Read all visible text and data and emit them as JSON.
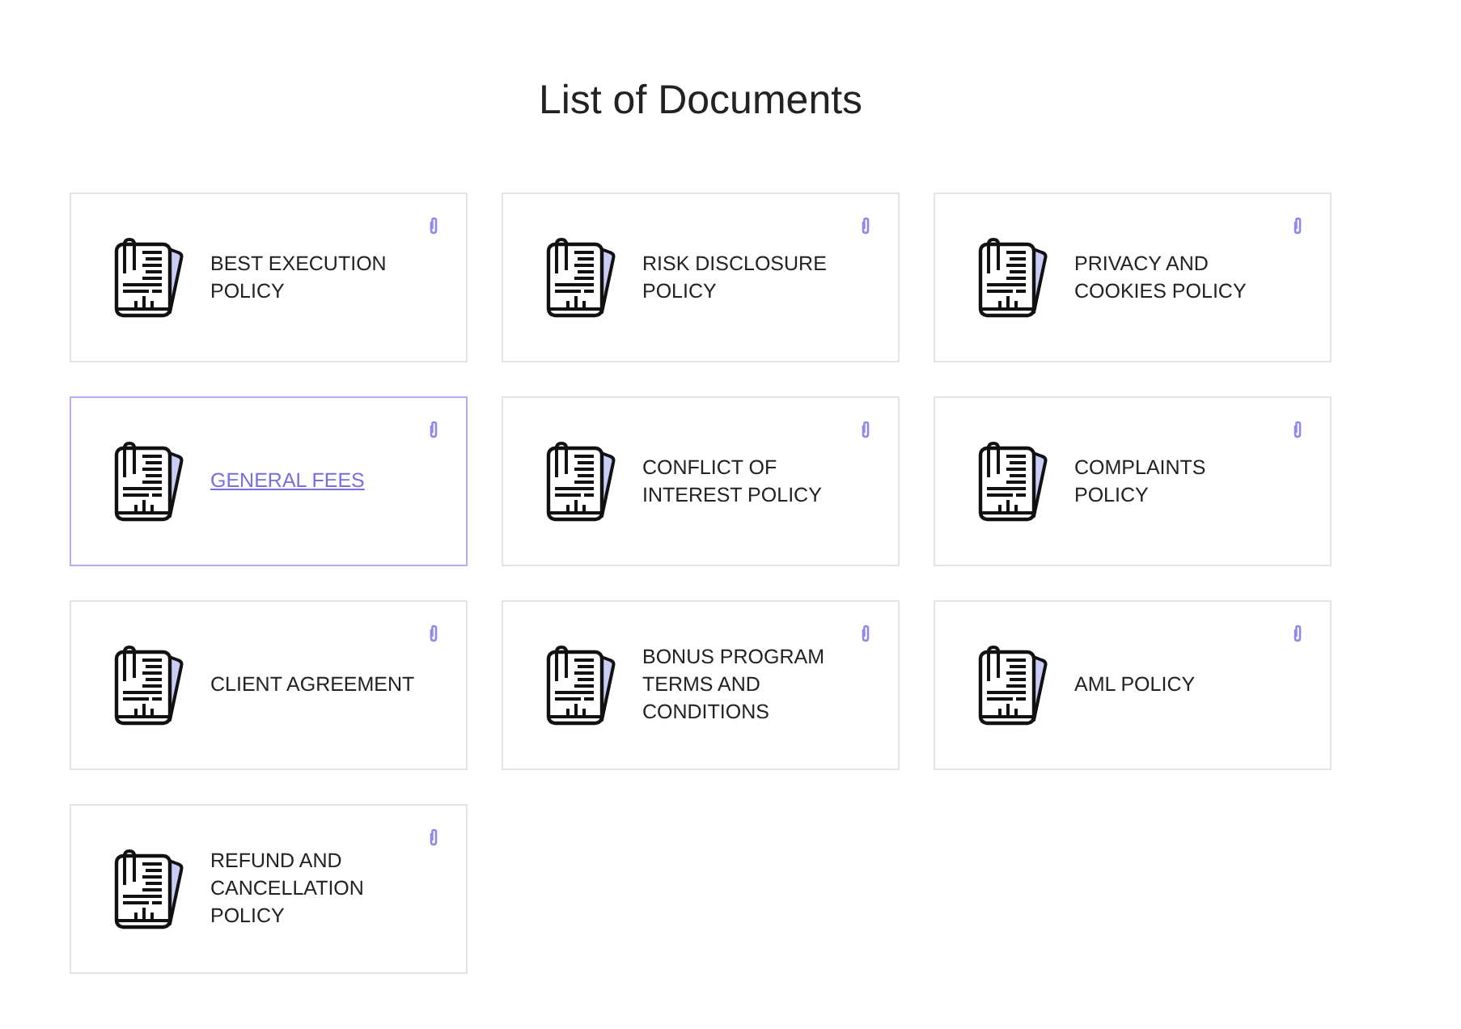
{
  "title": "List of Documents",
  "documents": [
    {
      "label": "BEST EXECUTION POLICY",
      "selected": false
    },
    {
      "label": "RISK DISCLOSURE POLICY",
      "selected": false
    },
    {
      "label": "PRIVACY AND COOKIES POLICY",
      "selected": false
    },
    {
      "label": "GENERAL FEES",
      "selected": true
    },
    {
      "label": "CONFLICT OF INTEREST POLICY",
      "selected": false
    },
    {
      "label": "COMPLAINTS POLICY",
      "selected": false
    },
    {
      "label": "CLIENT AGREEMENT",
      "selected": false
    },
    {
      "label": "BONUS PROGRAM TERMS AND CONDITIONS",
      "selected": false
    },
    {
      "label": "AML POLICY",
      "selected": false
    },
    {
      "label": "REFUND AND CANCELLATION POLICY",
      "selected": false
    }
  ]
}
